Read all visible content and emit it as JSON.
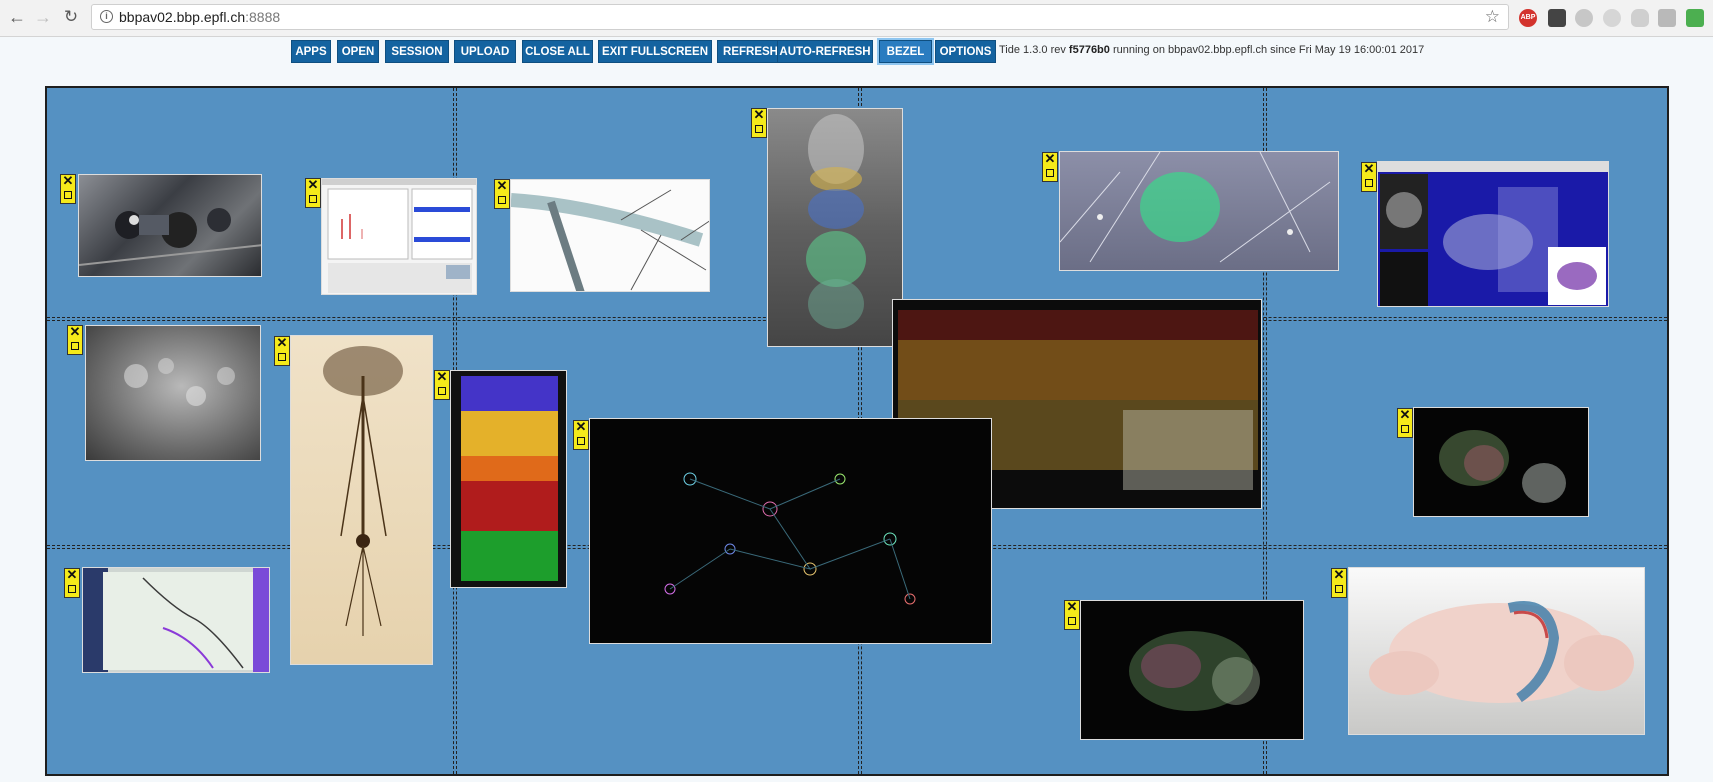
{
  "browser": {
    "url_host": "bbpav02.bbp.epfl.ch",
    "url_port": ":8888",
    "abp_label": "ABP"
  },
  "toolbar": {
    "buttons": [
      "APPS",
      "OPEN",
      "SESSION",
      "UPLOAD",
      "CLOSE ALL",
      "EXIT FULLSCREEN",
      "REFRESH",
      "AUTO-REFRESH",
      "BEZEL",
      "OPTIONS"
    ],
    "active": "BEZEL"
  },
  "status": {
    "prefix": "Tide 1.3.0 rev",
    "rev": "f5776b0",
    "suffix": "running on bbpav02.bbp.epfl.ch since Fri May 19 16:00:01 2017"
  },
  "windows": [
    {
      "name": "electrode-rig-photo"
    },
    {
      "name": "signal-plot-screenshot"
    },
    {
      "name": "dendrite-render"
    },
    {
      "name": "cortical-column-render"
    },
    {
      "name": "neuron-cluster-render"
    },
    {
      "name": "brain-atlas-viewer"
    },
    {
      "name": "calcium-imaging-frame"
    },
    {
      "name": "pyramidal-neuron-stain"
    },
    {
      "name": "layered-column-density"
    },
    {
      "name": "neuron-network-render"
    },
    {
      "name": "cortical-slice-render"
    },
    {
      "name": "brain-volume-small"
    },
    {
      "name": "tablet-tracing-photo"
    },
    {
      "name": "brain-volume-render"
    },
    {
      "name": "mouse-brain-3d"
    }
  ],
  "colors": {
    "wall": "#5591c2",
    "toolbar_button": "#1463a0",
    "window_control": "#f5ea1a"
  }
}
